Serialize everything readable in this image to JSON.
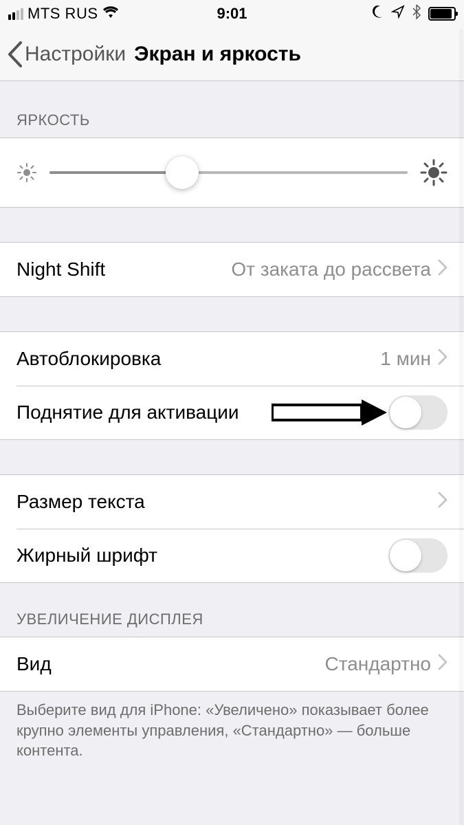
{
  "status_bar": {
    "carrier": "MTS RUS",
    "time": "9:01"
  },
  "nav": {
    "back_label": "Настройки",
    "title": "Экран и яркость"
  },
  "sections": {
    "brightness_header": "ЯРКОСТЬ",
    "display_zoom_header": "УВЕЛИЧЕНИЕ ДИСПЛЕЯ",
    "display_zoom_footer": "Выберите вид для iPhone: «Увеличено» показывает более крупно элементы управления, «Стандартно» — больше контента."
  },
  "rows": {
    "night_shift_label": "Night Shift",
    "night_shift_value": "От заката до рассвета",
    "auto_lock_label": "Автоблокировка",
    "auto_lock_value": "1 мин",
    "raise_to_wake_label": "Поднятие для активации",
    "text_size_label": "Размер текста",
    "bold_text_label": "Жирный шрифт",
    "view_label": "Вид",
    "view_value": "Стандартно"
  },
  "brightness_slider": {
    "percent": 37
  },
  "toggles": {
    "raise_to_wake": false,
    "bold_text": false
  }
}
